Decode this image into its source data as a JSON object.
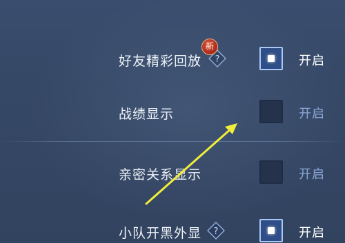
{
  "badge": {
    "new_label": "新"
  },
  "settings": [
    {
      "label": "好友精彩回放",
      "has_help": true,
      "enabled": true,
      "state_label": "开启"
    },
    {
      "label": "战绩显示",
      "has_help": false,
      "enabled": false,
      "state_label": "开启"
    },
    {
      "label": "亲密关系显示",
      "has_help": false,
      "enabled": false,
      "state_label": "开启"
    },
    {
      "label": "小队开黑外显",
      "has_help": true,
      "enabled": true,
      "state_label": "开启"
    }
  ],
  "annotation": {
    "color": "#f2ee3a",
    "icon": "arrow-icon"
  },
  "colors": {
    "background": "#354866",
    "checkbox_on": "#2f4d86",
    "text_off": "#8aa7d6"
  }
}
